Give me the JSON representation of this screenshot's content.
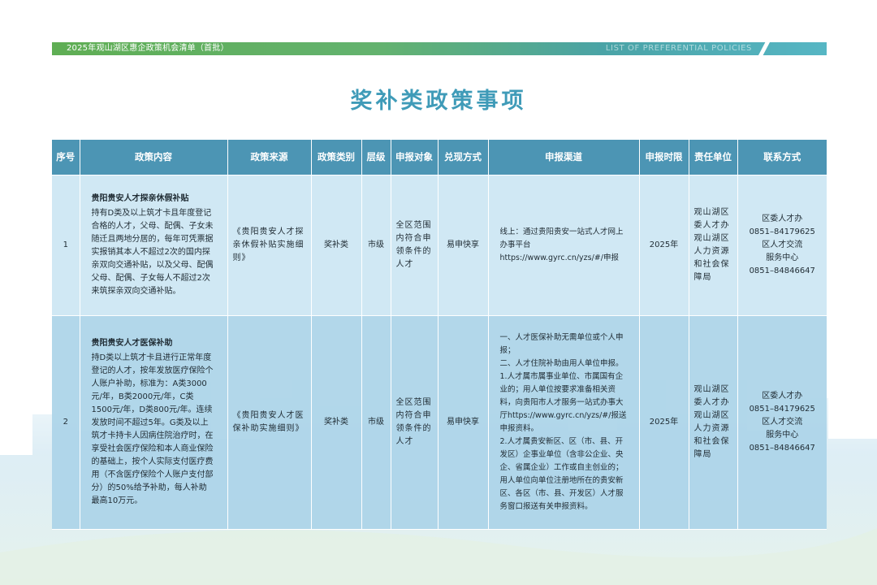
{
  "header": {
    "left_text": "2025年观山湖区惠企政策机会清单（首批）",
    "right_text": "LIST OF PREFERENTIAL POLICIES"
  },
  "title": "奖补类政策事项",
  "columns": [
    "序号",
    "政策内容",
    "政策来源",
    "政策类别",
    "层级",
    "申报对象",
    "兑现方式",
    "申报渠道",
    "申报时限",
    "责任单位",
    "联系方式"
  ],
  "rows": [
    {
      "no": "1",
      "content_title": "贵阳贵安人才探亲休假补贴",
      "content_body": "持有D类及以上筑才卡且年度登记合格的人才，父母、配偶、子女未随迁且两地分居的，每年可凭票据实报销其本人不超过2次的国内探亲双向交通补贴，以及父母、配偶父母、配偶、子女每人不超过2次来筑探亲双向交通补贴。",
      "source": "《贵阳贵安人才探亲休假补贴实施细则》",
      "category": "奖补类",
      "level": "市级",
      "target": "全区范围内符合申领条件的人才",
      "method": "易申快享",
      "channel": [
        "线上：通过贵阳贵安一站式人才网上办事平台",
        "https://www.gyrc.cn/yzs/#/申报"
      ],
      "deadline": "2025年",
      "unit": "观山湖区委人才办观山湖区人力资源和社会保障局",
      "contact": [
        "区委人才办",
        "0851–84179625",
        "区人才交流",
        "服务中心",
        "0851–84846647"
      ]
    },
    {
      "no": "2",
      "content_title": "贵阳贵安人才医保补助",
      "content_body": "持D类以上筑才卡且进行正常年度登记的人才，按年发放医疗保险个人账户补助，标准为：A类3000元/年，B类2000元/年，C类1500元/年，D类800元/年。连续发放时间不超过5年。G类及以上筑才卡持卡人因病住院治疗时，在享受社会医疗保险和本人商业保险的基础上，按个人实际支付医疗费用（不含医疗保险个人账户支付部分）的50%给予补助，每人补助最高10万元。",
      "source": "《贵阳贵安人才医保补助实施细则》",
      "category": "奖补类",
      "level": "市级",
      "target": "全区范围内符合申领条件的人才",
      "method": "易申快享",
      "channel": [
        "一、人才医保补助无需单位或个人申报；",
        "二、人才住院补助由用人单位申报。",
        "1.人才属市属事业单位、市属国有企业的；用人单位按要求准备相关资料，向贵阳市人才服务一站式办事大厅https://www.gyrc.cn/yzs/#/报送申报资料。",
        "2.人才属贵安新区、区（市、县、开发区）企事业单位（含非公企业、央企、省属企业）工作或自主创业的；用人单位向单位注册地所在的贵安新区、各区（市、县、开发区）人才服务窗口报送有关申报资料。"
      ],
      "deadline": "2025年",
      "unit": "观山湖区委人才办观山湖区人力资源和社会保障局",
      "contact": [
        "区委人才办",
        "0851–84179625",
        "区人才交流",
        "服务中心",
        "0851–84846647"
      ]
    }
  ],
  "colors": {
    "title": "#3f9bb8",
    "table_header": "#4c95b4",
    "row1_bg": "#cce6f3",
    "row2_bg": "#acd4e8",
    "band_green": "#5fae54",
    "band_teal": "#4aa3a6"
  }
}
